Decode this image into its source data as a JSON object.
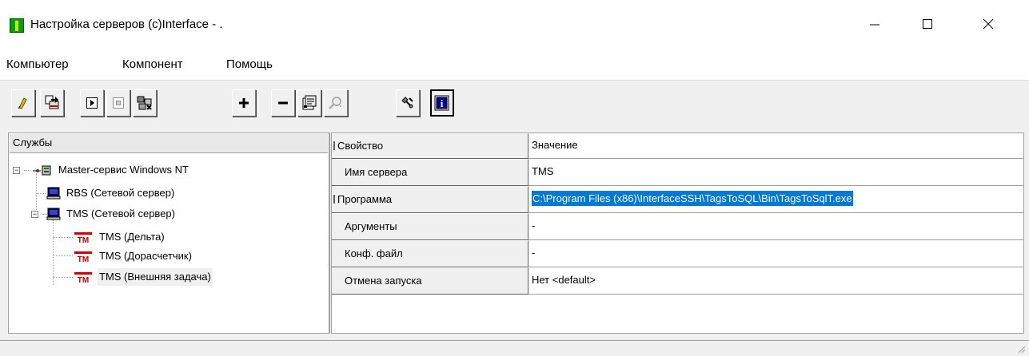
{
  "window": {
    "title": "Настройка серверов (c)Interface - .",
    "icon": "app-icon",
    "controls": [
      "minimize-icon",
      "maximize-icon",
      "close-icon"
    ]
  },
  "menu": {
    "items": [
      "Компьютер",
      "Компонент",
      "Помощь"
    ]
  },
  "toolbar": {
    "buttons": [
      {
        "icon": "connect-icon"
      },
      {
        "icon": "export-icon"
      },
      {
        "icon": "start-icon"
      },
      {
        "icon": "stop-icon"
      },
      {
        "icon": "services-icon"
      },
      {
        "icon": "add-icon"
      },
      {
        "icon": "remove-icon"
      },
      {
        "icon": "properties-icon"
      },
      {
        "icon": "find-icon"
      },
      {
        "icon": "tools-icon"
      },
      {
        "icon": "info-icon"
      }
    ]
  },
  "tree": {
    "header": "Службы",
    "nodes": [
      {
        "label": "Master-сервис Windows NT",
        "icon": "network-master-icon",
        "level": 0,
        "expanded": true
      },
      {
        "label": "RBS (Сетевой сервер)",
        "icon": "computer-icon",
        "level": 1
      },
      {
        "label": "TMS (Сетевой сервер)",
        "icon": "computer-icon",
        "level": 1,
        "expanded": true
      },
      {
        "label": "TMS (Дельта)",
        "icon": "tm-icon",
        "level": 2
      },
      {
        "label": "TMS (Дорасчетчик)",
        "icon": "tm-icon",
        "level": 2
      },
      {
        "label": "TMS (Внешняя задача)",
        "icon": "tm-icon",
        "level": 2,
        "selected": true
      }
    ]
  },
  "grid": {
    "header": {
      "property": "Свойство",
      "value": "Значение"
    },
    "rows": [
      {
        "property": "Имя сервера",
        "value": "TMS"
      },
      {
        "property": "Программа",
        "value": "C:\\Program Files (x86)\\InterfaceSSH\\TagsToSQL\\Bin\\TagsToSqlT.exe",
        "selected": true
      },
      {
        "property": "Аргументы",
        "value": "-"
      },
      {
        "property": "Конф. файл",
        "value": "-"
      },
      {
        "property": "Отмена запуска",
        "value": "Нет <default>"
      }
    ]
  },
  "colors": {
    "selection": "#0078d7",
    "tm_icon": "#cc0000",
    "app_icon": "#00a000"
  }
}
